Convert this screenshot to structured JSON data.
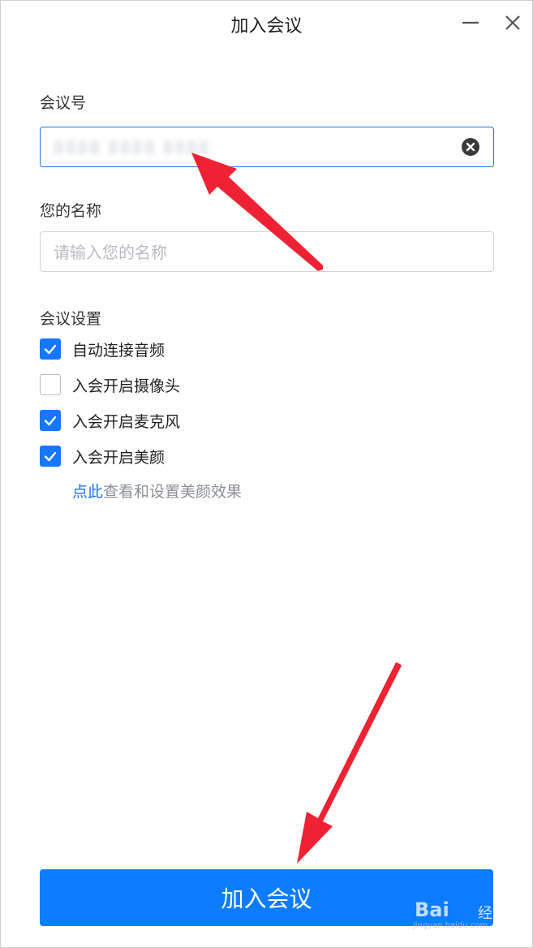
{
  "window": {
    "title": "加入会议"
  },
  "form": {
    "meeting_id_label": "会议号",
    "meeting_id_value": "8888 8888 8888",
    "name_label": "您的名称",
    "name_placeholder": "请输入您的名称",
    "settings_label": "会议设置"
  },
  "settings": [
    {
      "label": "自动连接音频",
      "checked": true
    },
    {
      "label": "入会开启摄像头",
      "checked": false
    },
    {
      "label": "入会开启麦克风",
      "checked": true
    },
    {
      "label": "入会开启美颜",
      "checked": true
    }
  ],
  "beauty": {
    "link_text": "点此",
    "description": "查看和设置美颜效果"
  },
  "join_button_label": "加入会议",
  "watermark": {
    "brand": "Bai",
    "sub": "经验",
    "url": "jingyan.baidu.com"
  },
  "colors": {
    "accent": "#1677ff",
    "button": "#0e7cff",
    "annotation_arrow": "#ee2233"
  }
}
